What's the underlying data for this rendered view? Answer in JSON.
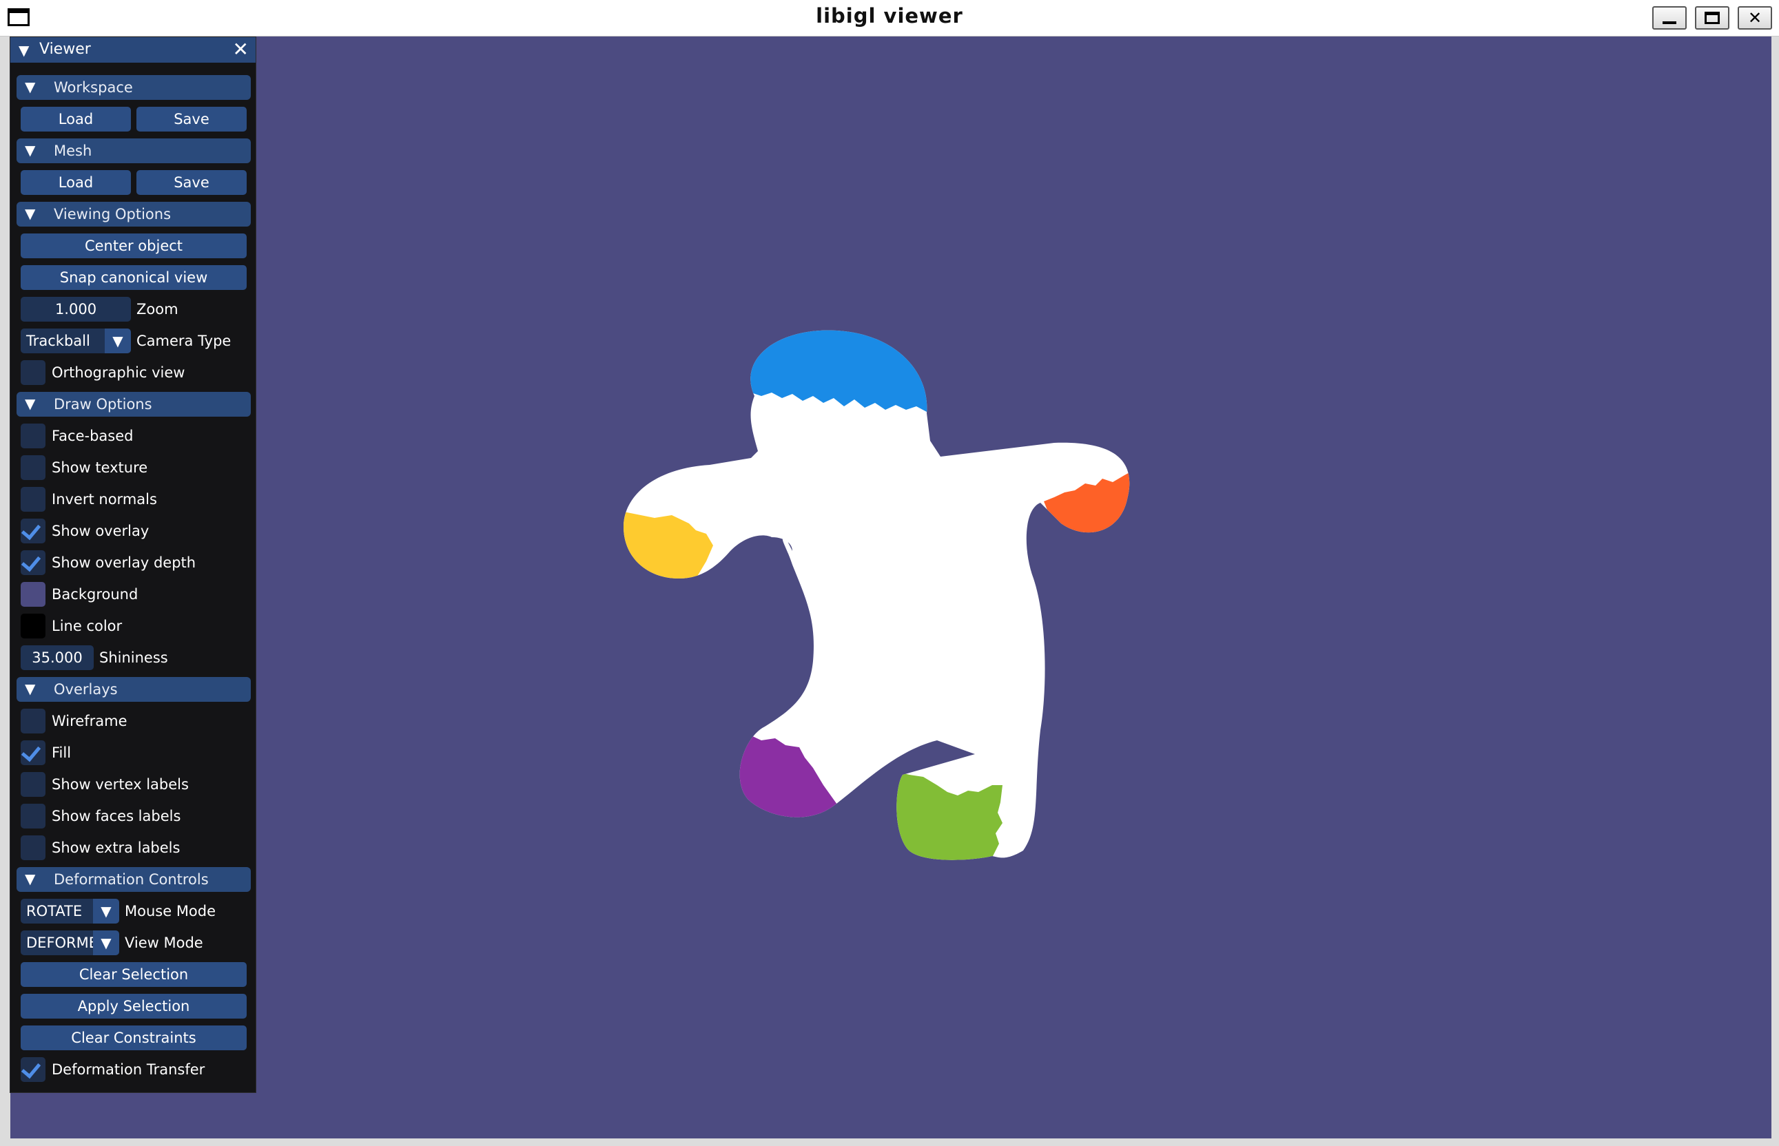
{
  "window": {
    "title": "libigl viewer",
    "minimize_icon": "minimize-icon",
    "maximize_icon": "maximize-icon",
    "close_icon": "close-icon"
  },
  "panel": {
    "title": "Viewer",
    "close_glyph": "✕",
    "collapse_glyph": "▼",
    "sections": {
      "workspace": {
        "label": "Workspace",
        "load": "Load",
        "save": "Save"
      },
      "mesh": {
        "label": "Mesh",
        "load": "Load",
        "save": "Save"
      },
      "viewing": {
        "label": "Viewing Options",
        "center": "Center object",
        "snap": "Snap canonical view",
        "zoom_value": "1.000",
        "zoom_label": "Zoom",
        "camera_value": "Trackball",
        "camera_label": "Camera Type",
        "ortho_label": "Orthographic view",
        "ortho_checked": false
      },
      "draw": {
        "label": "Draw Options",
        "face_based": "Face-based",
        "show_texture": "Show texture",
        "invert_normals": "Invert normals",
        "show_overlay": "Show overlay",
        "show_overlay_depth": "Show overlay depth",
        "background": "Background",
        "background_color": "#4c4b81",
        "line_color": "Line color",
        "line_color_value": "#000000",
        "shininess_value": "35.000",
        "shininess_label": "Shininess"
      },
      "overlays": {
        "label": "Overlays",
        "wireframe": "Wireframe",
        "fill": "Fill",
        "vertex_labels": "Show vertex labels",
        "faces_labels": "Show faces labels",
        "extra_labels": "Show extra labels"
      },
      "deformation": {
        "label": "Deformation Controls",
        "mouse_value": "ROTATE",
        "mouse_label": "Mouse Mode",
        "view_value": "DEFORMED",
        "view_label": "View Mode",
        "clear_selection": "Clear Selection",
        "apply_selection": "Apply Selection",
        "clear_constraints": "Clear Constraints",
        "transfer": "Deformation Transfer"
      }
    }
  },
  "colors": {
    "viewport_bg": "#4c4b81",
    "mesh": "#ffffff",
    "head": "#1a8be6",
    "left_hand": "#fecb2f",
    "right_hand": "#fe6127",
    "left_foot": "#8b2fa3",
    "right_foot": "#82bd36",
    "accent": "#2c4e84"
  }
}
